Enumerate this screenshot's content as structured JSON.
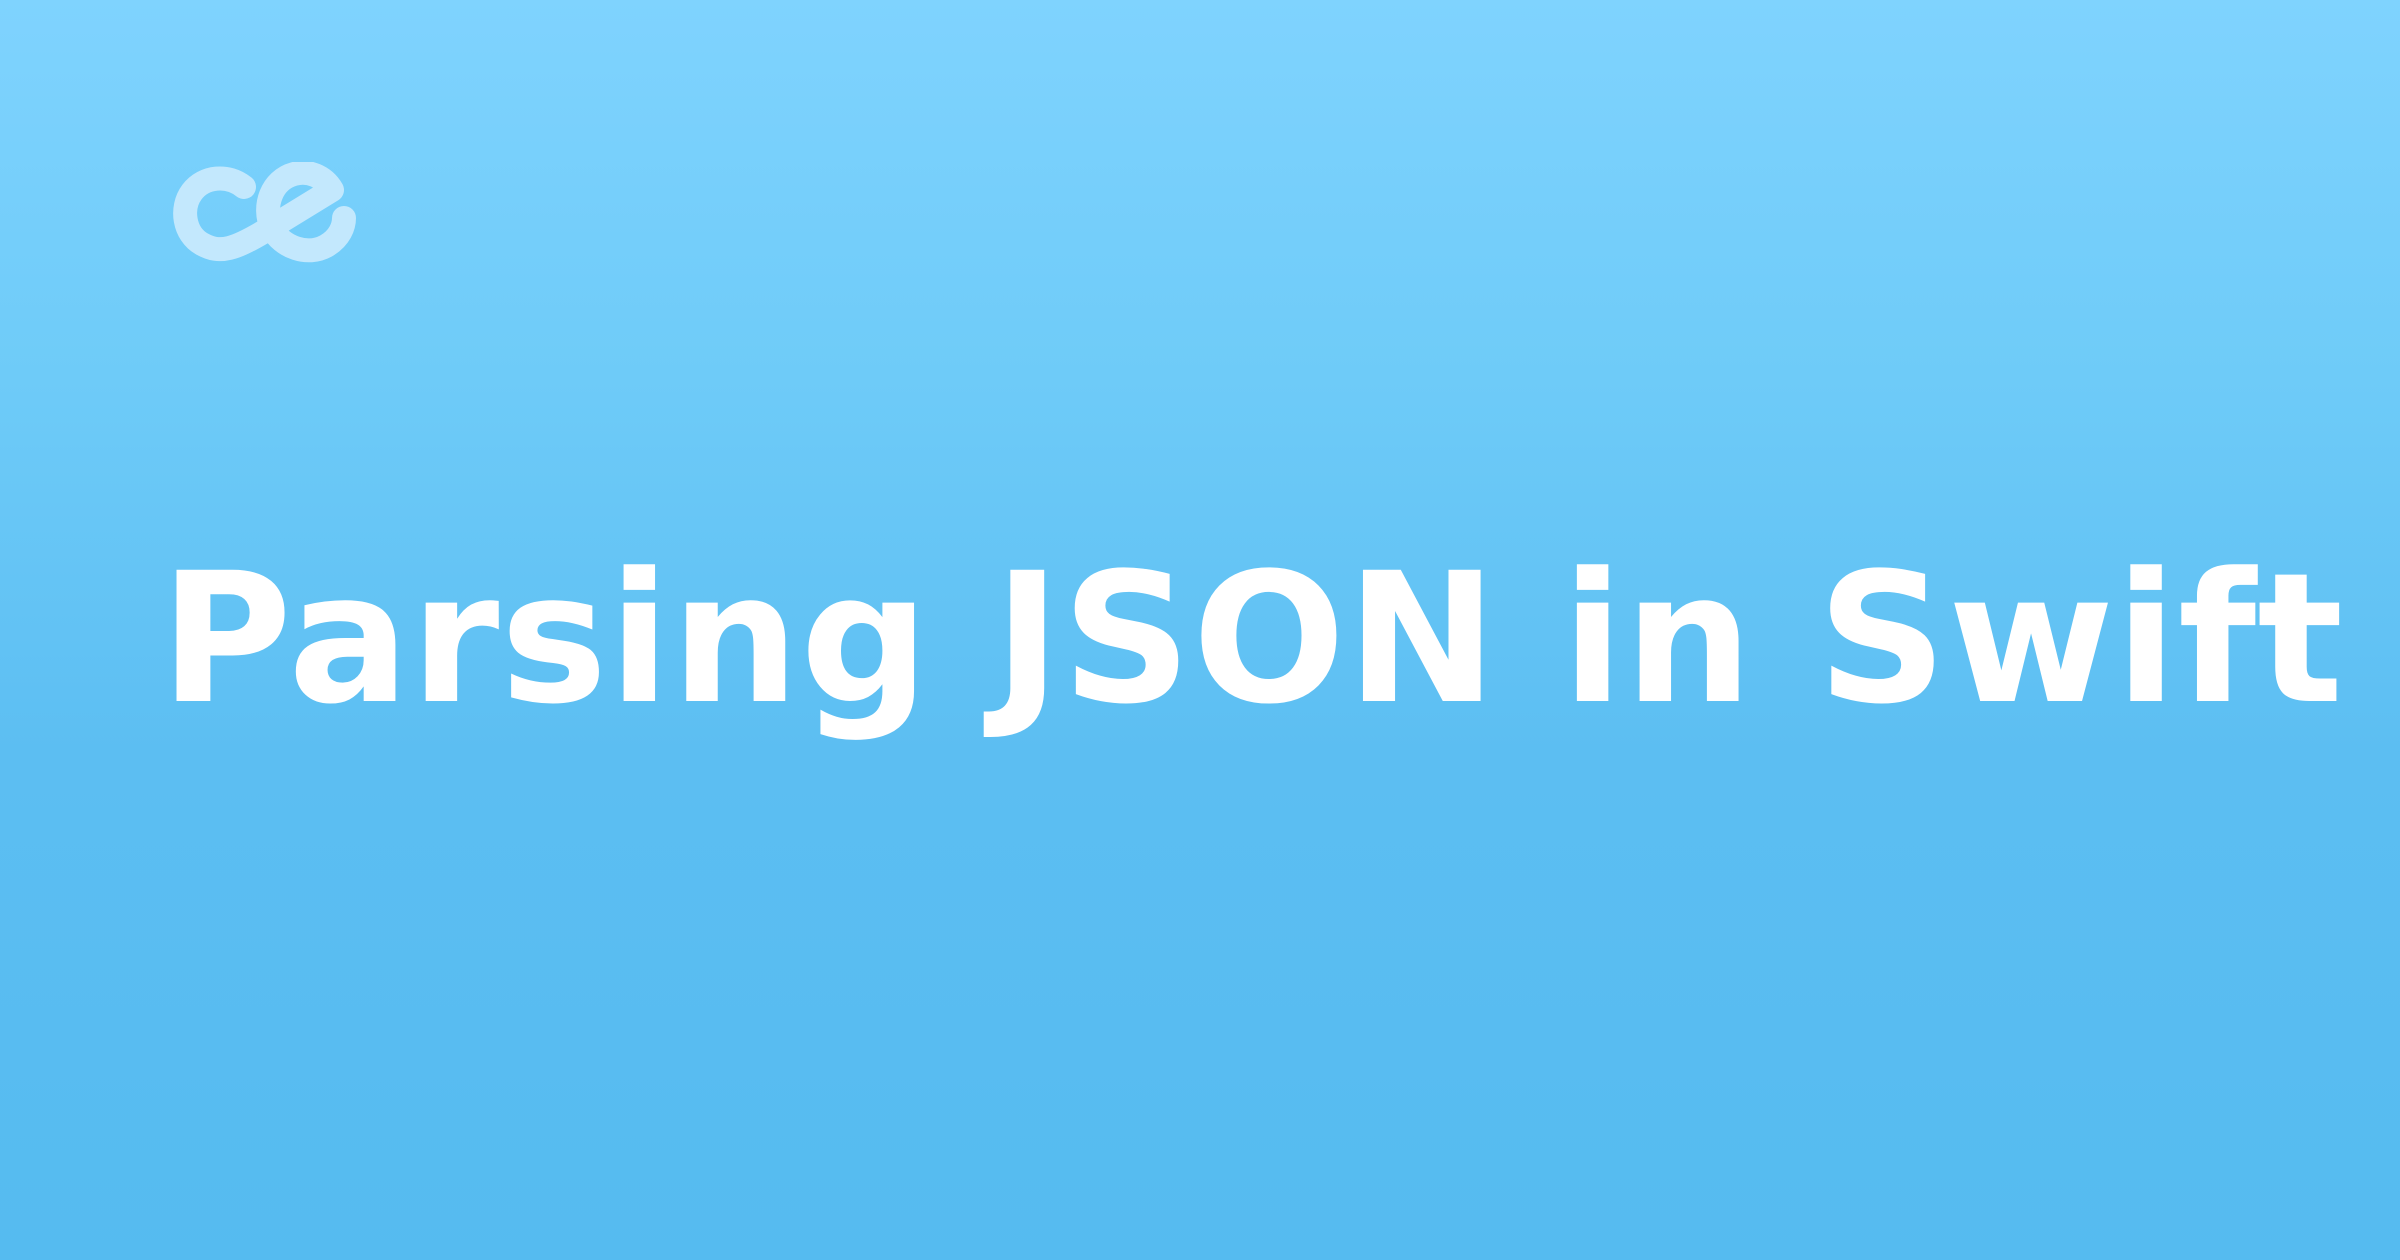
{
  "logo": {
    "icon": "ce-logo-icon",
    "color": "#c3e8fd"
  },
  "title": "Parsing JSON in Swift",
  "colors": {
    "background_top": "#7fd3fe",
    "background_bottom": "#55bbf0",
    "title": "#ffffff"
  }
}
